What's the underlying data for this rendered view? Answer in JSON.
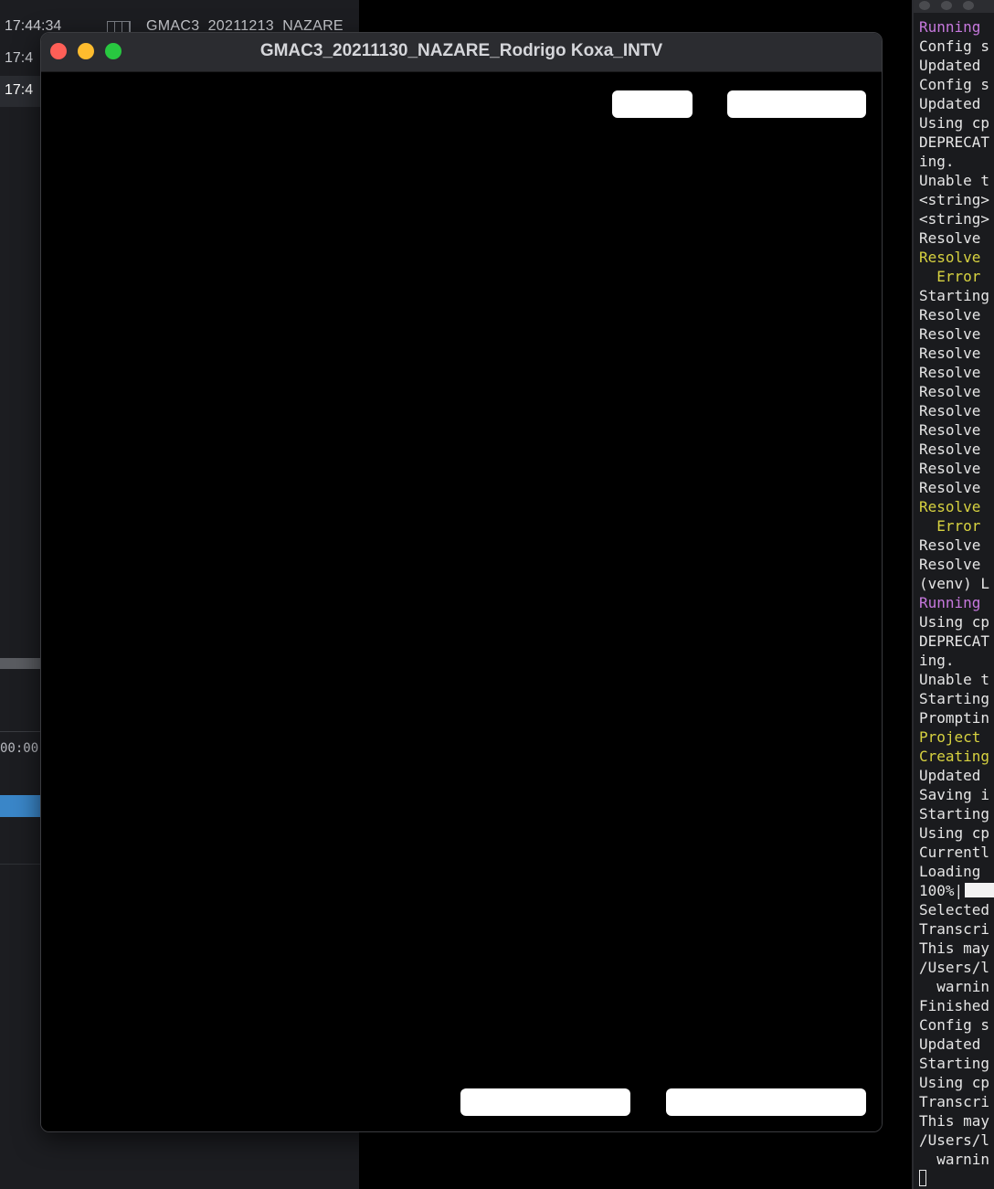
{
  "background_app": {
    "rows": [
      {
        "time": "17:44:34",
        "filename": "GMAC3_20211213_NAZARE"
      },
      {
        "time": "17:4"
      },
      {
        "time": "17:4"
      }
    ],
    "timecode": "00:00"
  },
  "window": {
    "title": "GMAC3_20211130_NAZARE_Rodrigo Koxa_INTV",
    "buttons": {
      "top_left": "",
      "top_right": "",
      "bottom_left": "",
      "bottom_right": ""
    }
  },
  "terminal": {
    "lines": [
      {
        "text": "Running",
        "color": "purple"
      },
      {
        "text": "Config s",
        "color": "white"
      },
      {
        "text": "Updated",
        "color": "white"
      },
      {
        "text": "Config s",
        "color": "white"
      },
      {
        "text": "Updated",
        "color": "white"
      },
      {
        "text": "Using cp",
        "color": "white"
      },
      {
        "text": "DEPRECAT",
        "color": "white"
      },
      {
        "text": "ing.",
        "color": "white"
      },
      {
        "text": "Unable t",
        "color": "white"
      },
      {
        "text": "<string>",
        "color": "white"
      },
      {
        "text": "<string>",
        "color": "white"
      },
      {
        "text": "Resolve",
        "color": "white"
      },
      {
        "text": "Resolve",
        "color": "yellow"
      },
      {
        "text": "  Error",
        "color": "yellow"
      },
      {
        "text": "Starting",
        "color": "white"
      },
      {
        "text": "Resolve",
        "color": "white"
      },
      {
        "text": "Resolve",
        "color": "white"
      },
      {
        "text": "Resolve",
        "color": "white"
      },
      {
        "text": "Resolve",
        "color": "white"
      },
      {
        "text": "Resolve",
        "color": "white"
      },
      {
        "text": "Resolve",
        "color": "white"
      },
      {
        "text": "Resolve",
        "color": "white"
      },
      {
        "text": "Resolve",
        "color": "white"
      },
      {
        "text": "Resolve",
        "color": "white"
      },
      {
        "text": "Resolve",
        "color": "white"
      },
      {
        "text": "Resolve",
        "color": "yellow"
      },
      {
        "text": "  Error",
        "color": "yellow"
      },
      {
        "text": "Resolve",
        "color": "white"
      },
      {
        "text": "Resolve",
        "color": "white"
      },
      {
        "text": "(venv) L",
        "color": "white"
      },
      {
        "text": "Running",
        "color": "purple"
      },
      {
        "text": "Using cp",
        "color": "white"
      },
      {
        "text": "DEPRECAT",
        "color": "white"
      },
      {
        "text": "ing.",
        "color": "white"
      },
      {
        "text": "Unable t",
        "color": "white"
      },
      {
        "text": "Starting",
        "color": "white"
      },
      {
        "text": "Promptin",
        "color": "white"
      },
      {
        "text": "Project",
        "color": "yellow"
      },
      {
        "text": "Creating",
        "color": "yellow"
      },
      {
        "text": "Updated",
        "color": "white"
      },
      {
        "text": "Saving i",
        "color": "white"
      },
      {
        "text": "Starting",
        "color": "white"
      },
      {
        "text": "Using cp",
        "color": "white"
      },
      {
        "text": "Currentl",
        "color": "white"
      },
      {
        "text": "Loading",
        "color": "white"
      },
      {
        "text": "100%|",
        "color": "white",
        "progress": true
      },
      {
        "text": "Selected",
        "color": "white"
      },
      {
        "text": "Transcri",
        "color": "white"
      },
      {
        "text": "This may",
        "color": "white"
      },
      {
        "text": "/Users/l",
        "color": "white"
      },
      {
        "text": "  warnin",
        "color": "white"
      },
      {
        "text": "Finished",
        "color": "white"
      },
      {
        "text": "Config s",
        "color": "white"
      },
      {
        "text": "Updated",
        "color": "white"
      },
      {
        "text": "Starting",
        "color": "white"
      },
      {
        "text": "Using cp",
        "color": "white"
      },
      {
        "text": "Transcri",
        "color": "white"
      },
      {
        "text": "This may",
        "color": "white"
      },
      {
        "text": "/Users/l",
        "color": "white"
      },
      {
        "text": "  warnin",
        "color": "white"
      }
    ]
  },
  "colors": {
    "close": "#fe5f57",
    "minimize": "#febc2e",
    "maximize": "#28c840",
    "term_purple": "#c678dd",
    "term_yellow": "#d7d240",
    "clip_blue": "#3a86c8"
  }
}
